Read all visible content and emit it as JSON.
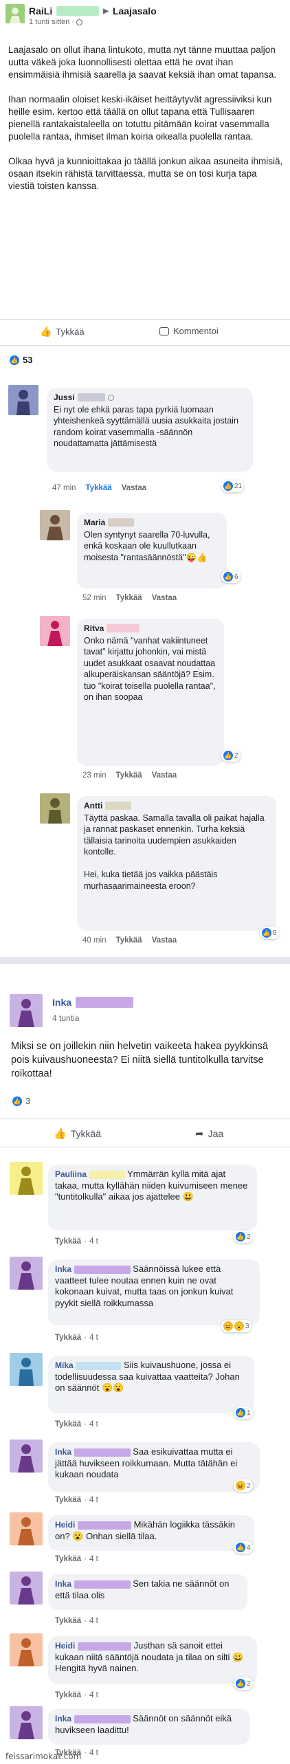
{
  "colors": {
    "like_blue": "#1877f2",
    "name_blue": "#385898",
    "bubble": "#f0f2f5"
  },
  "post1": {
    "author": "RaiLi",
    "group": "Laajasalo",
    "time": "1 tunti sitten ·",
    "body": "Laajasalo on ollut ihana lintukoto, mutta nyt tänne muuttaa paljon uutta väkeä joka luonnollisesti olettaa että he ovat ihan ensimmäisiä ihmisiä saarella ja saavat keksiä ihan omat tapansa.\n\nIhan normaalin oloiset keski-ikäiset heittäytyvät agressiiviksi kun\nheille esim. kertoo että täällä on ollut tapana että Tullisaaren pienellä rantakaistaleella on totuttu pitämään koirat vasemmalla puolella rantaa, ihmiset ilman koiria oikealla puolella rantaa.\n\nOlkaa hyvä ja kunnioittakaa jo täällä jonkun aikaa asuneita ihmisiä, osaan itsekin rähistä tarvittaessa, mutta se on tosi kurja tapa viestiä toisten kanssa.",
    "like_label": "Tykkää",
    "comment_label": "Kommentoi",
    "reactions": "53",
    "comments": [
      {
        "name": "Jussi",
        "text": "Ei nyt ole ehkä paras tapa pyrkiä luomaan yhteishenkeä syyttämällä uusia asukkaita jostain random koirat vasemmalla -säännön noudattamatta jättämisestä",
        "time": "47 min",
        "like": "Tykkää",
        "reply": "Vastaa",
        "reactions": "21"
      },
      {
        "name": "Maria",
        "text": "Olen syntynyt saarella 70-luvulla, enkä koskaan ole kuullutkaan moisesta \"rantasäännöstä\"😜👍",
        "time": "52 min",
        "like": "Tykkää",
        "reply": "Vastaa",
        "reactions": "6"
      },
      {
        "name": "Ritva",
        "text": "Onko nämä \"vanhat vakiintuneet tavat\" kirjattu johonkin, vai mistä uudet asukkaat osaavat noudattaa alkuperäiskansan sääntöjä? Esim. tuo \"koirat toisella puolella rantaa\", on ihan soopaa",
        "time": "23 min",
        "like": "Tykkää",
        "reply": "Vastaa",
        "reactions": "2"
      },
      {
        "name": "Antti",
        "text": "Täyttä paskaa. Samalla tavalla oli paikat hajalla ja rannat paskaset ennenkin. Turha keksiä tällaisia tarinoita uudempien asukkaiden kontolle.\n\nHei, kuka tietää jos vaikka päästäis murhasaarimaineesta eroon?",
        "time": "40 min",
        "like": "Tykkää",
        "reply": "Vastaa",
        "reactions": "6"
      }
    ]
  },
  "post2": {
    "author": "Inka",
    "time": "4 tuntia",
    "body": "Miksi se on joillekin niin helvetin vaikeeta hakea pyykkinsä pois kuivaushuoneesta? Ei niitä siellä tuntitolkulla tarvitse roikottaa!",
    "reactions": "3",
    "like_label": "Tykkää",
    "share_label": "Jaa",
    "comments": [
      {
        "name": "Pauliina",
        "text": "Ymmärrän kyllä mitä ajat takaa, mutta kyllähän niiden kuivumiseen menee \"tuntitolkulla\" aikaa jos ajattelee 😃",
        "like": "Tykkää",
        "time": "4 t",
        "reactions": "2"
      },
      {
        "name": "Inka",
        "text": "Säännöissä lukee että vaatteet tulee noutaa ennen kuin ne ovat kokonaan kuivat, mutta taas on jonkun kuivat pyykit siellä roikkumassa",
        "like": "Tykkää",
        "time": "4 t",
        "reactions": "3"
      },
      {
        "name": "Mika",
        "text": "Siis kuivaushuone, jossa ei todellisuudessa saa kuivattaa vaatteita? Johan on säännöt 😮😮",
        "like": "Tykkää",
        "time": "4 t",
        "reactions": "1"
      },
      {
        "name": "Inka",
        "text": "Saa esikuivattaa mutta ei jättää huvikseen roikkumaan. Mutta tätähän ei kukaan noudata",
        "like": "Tykkää",
        "time": "4 t",
        "reactions": "2"
      },
      {
        "name": "Heidi",
        "text": "Mikähän logiikka tässäkin on? 😮 Onhan siellä tilaa.",
        "like": "Tykkää",
        "time": "4 t",
        "reactions": "4"
      },
      {
        "name": "Inka",
        "text": "Sen takia ne säännöt on että tilaa olis",
        "like": "Tykkää",
        "time": "4 t",
        "reactions": ""
      },
      {
        "name": "Heidi",
        "text": "Justhan sä sanoit ettei kukaan niitä sääntöjä noudata ja tilaa on silti 😀 Hengitä hyvä nainen.",
        "like": "Tykkää",
        "time": "4 t",
        "reactions": "2"
      },
      {
        "name": "Inka",
        "text": "Säännöt on säännöt eikä huvikseen laadittu!",
        "like": "Tykkää",
        "time": "4 t",
        "reactions": ""
      }
    ]
  },
  "watermark": "feissarimokat.com"
}
